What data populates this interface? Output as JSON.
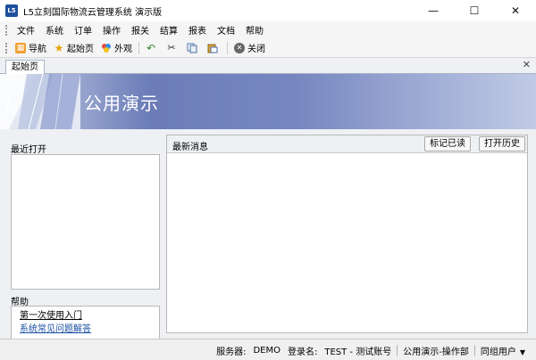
{
  "window": {
    "title": "L5立刻国际物流云管理系统 演示版",
    "icon_text": "L5",
    "controls": {
      "minimize": "—",
      "maximize": "☐",
      "close": "✕"
    }
  },
  "menu": [
    "文件",
    "系统",
    "订单",
    "操作",
    "报关",
    "结算",
    "报表",
    "文档",
    "帮助"
  ],
  "toolbar": {
    "nav": "导航",
    "home": "起始页",
    "theme": "外观",
    "close": "关闭"
  },
  "tabs": [
    {
      "label": "起始页"
    }
  ],
  "tab_close_glyph": "✕",
  "banner": {
    "title": "公用演示"
  },
  "left": {
    "recent_label": "最近打开",
    "help_label": "帮助",
    "help_links": [
      "第一次使用入门",
      "系统常见问题解答"
    ]
  },
  "news": {
    "title": "最新消息",
    "mark_read": "标记已读",
    "open_history": "打开历史"
  },
  "status": {
    "server_label": "服务器:",
    "server_value": "DEMO",
    "login_label": "登录名:",
    "login_value": "TEST - 测试账号",
    "dept": "公用演示-操作部",
    "group": "同组用户"
  },
  "colors": {
    "banner_mid": "#6b7cb8",
    "app_icon": "#1e4f9c",
    "link_blue": "#1a4fa3"
  }
}
